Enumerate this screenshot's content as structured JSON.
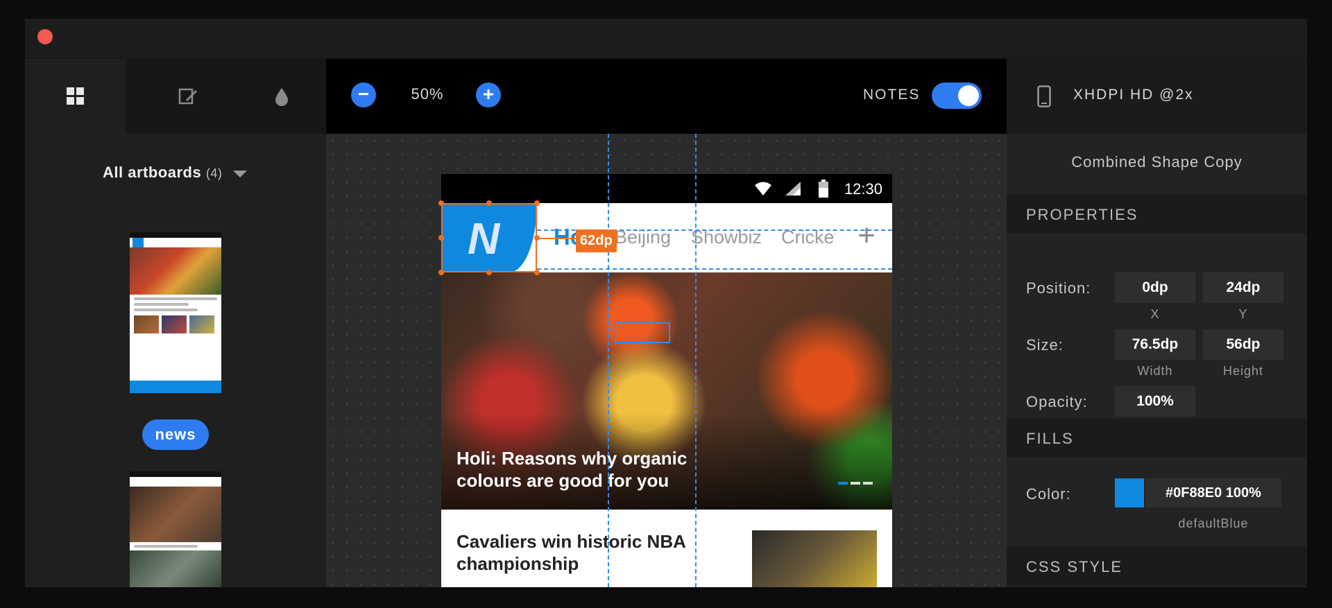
{
  "toolbar": {
    "zoom_minus": "−",
    "zoom_value": "50%",
    "zoom_plus": "+",
    "notes_label": "NOTES",
    "notes_on": true,
    "device_label": "XHDPI HD @2x"
  },
  "sidebar": {
    "title": "All artboards",
    "count": "(4)",
    "active_artboard": "news"
  },
  "artboard": {
    "status_time": "12:30",
    "logo_letter": "N",
    "tabs": [
      "Hot",
      "Beijing",
      "Showbiz",
      "Cricket"
    ],
    "add_tab": "+",
    "hero_title": "Holi: Reasons why organic colours are good for you",
    "article_title": "Cavaliers win historic NBA championship",
    "measure_badge": "62dp"
  },
  "inspector": {
    "layer_name": "Combined Shape Copy",
    "properties_header": "PROPERTIES",
    "position_label": "Position:",
    "position_x": "0dp",
    "position_y": "24dp",
    "x_label": "X",
    "y_label": "Y",
    "size_label": "Size:",
    "width": "76.5dp",
    "height": "56dp",
    "width_label": "Width",
    "height_label": "Height",
    "opacity_label": "Opacity:",
    "opacity": "100%",
    "fills_header": "FILLS",
    "color_label": "Color:",
    "color_value": "#0F88E0 100%",
    "color_name": "defaultBlue",
    "color_hex": "#0F88E0",
    "css_header": "CSS STYLE"
  }
}
